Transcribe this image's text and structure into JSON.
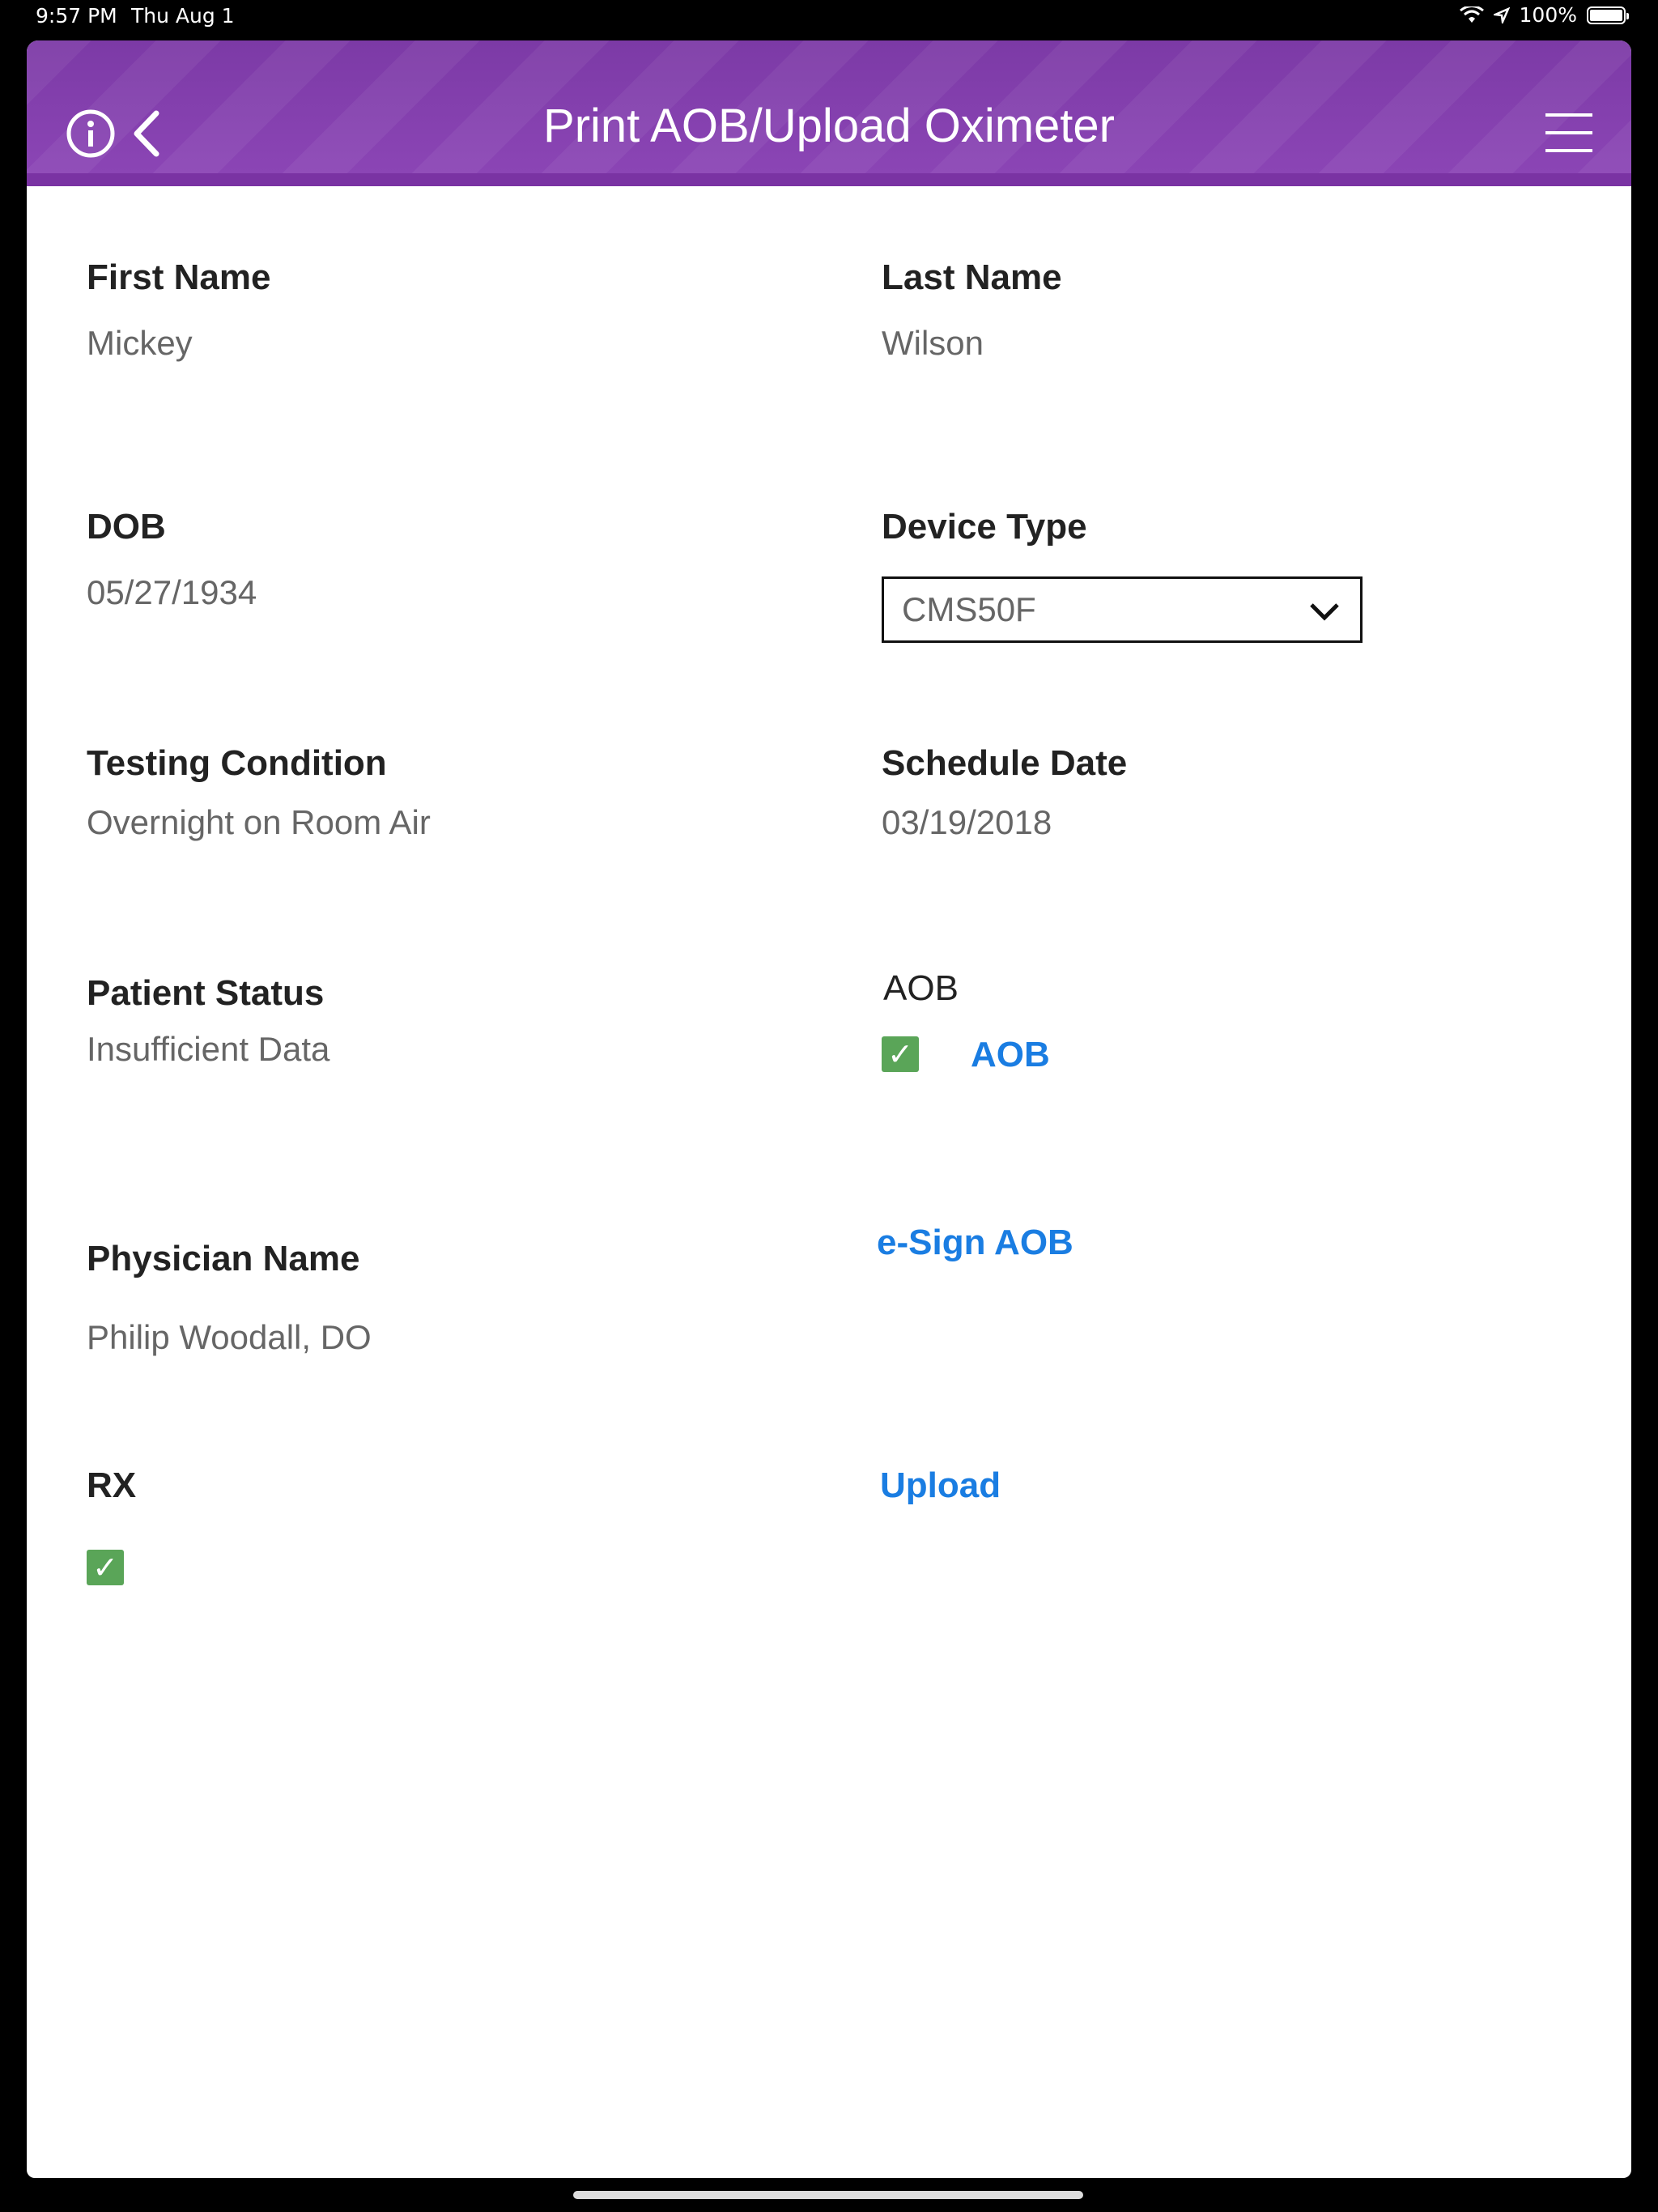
{
  "status_bar": {
    "time": "9:57 PM",
    "date": "Thu Aug 1",
    "battery": "100%"
  },
  "nav": {
    "title": "Print AOB/Upload Oximeter"
  },
  "form": {
    "first_name": {
      "label": "First Name",
      "value": "Mickey"
    },
    "last_name": {
      "label": "Last Name",
      "value": "Wilson"
    },
    "dob": {
      "label": "DOB",
      "value": "05/27/1934"
    },
    "device_type": {
      "label": "Device Type",
      "value": "CMS50F"
    },
    "testing_condition": {
      "label": "Testing Condition",
      "value": "Overnight on Room Air"
    },
    "schedule_date": {
      "label": "Schedule Date",
      "value": "03/19/2018"
    },
    "patient_status": {
      "label": "Patient Status",
      "value": "Insufficient Data"
    },
    "aob": {
      "label": "AOB",
      "link": "AOB",
      "checked": true
    },
    "physician_name": {
      "label": "Physician Name",
      "value": "Philip Woodall, DO"
    },
    "esign_link": "e-Sign AOB",
    "rx": {
      "label": "RX",
      "checked": true
    },
    "upload_link": "Upload"
  },
  "colors": {
    "nav_purple": "#8b45b5",
    "link_blue": "#1a7de2",
    "check_green": "#5aa558"
  }
}
